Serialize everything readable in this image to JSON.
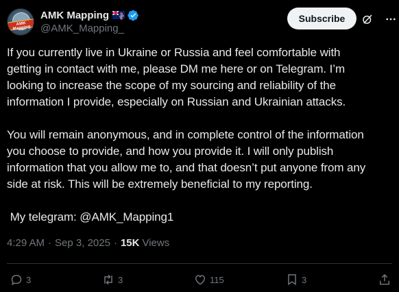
{
  "author": {
    "display_name": "AMK Mapping",
    "handle": "@AMK_Mapping_",
    "flag": "new-zealand-flag",
    "verified_badge": "verified-badge-icon",
    "avatar_text": "AMK Mapping"
  },
  "header": {
    "subscribe_label": "Subscribe",
    "grok_icon": "grok-icon",
    "more_icon": "more-icon"
  },
  "tweet": {
    "text": "If you currently live in Ukraine or Russia and feel comfortable with\ngetting in contact with me, please DM me here or on Telegram. I’m\nlooking to increase the scope of my sourcing and reliability of the\ninformation I provide, especially on Russian and Ukrainian attacks.\n\nYou will remain anonymous, and in complete control of the information\nyou choose to provide, and how you provide it. I will only publish\ninformation that you allow me to, and that doesn’t put anyone from any\nside at risk. This will be extremely beneficial to my reporting.\n\n My telegram: @AMK_Mapping1"
  },
  "meta": {
    "time": "4:29 AM",
    "separator": "·",
    "date": "Sep 3, 2025",
    "views_count": "15K",
    "views_label": "Views"
  },
  "actions": {
    "replies": "3",
    "reposts": "3",
    "likes": "115",
    "bookmarks": "3"
  },
  "colors": {
    "background": "#000000",
    "text": "#e7e9ea",
    "secondary": "#71767b",
    "verified": "#1d9bf0",
    "subscribe_bg": "#eff3f4"
  }
}
